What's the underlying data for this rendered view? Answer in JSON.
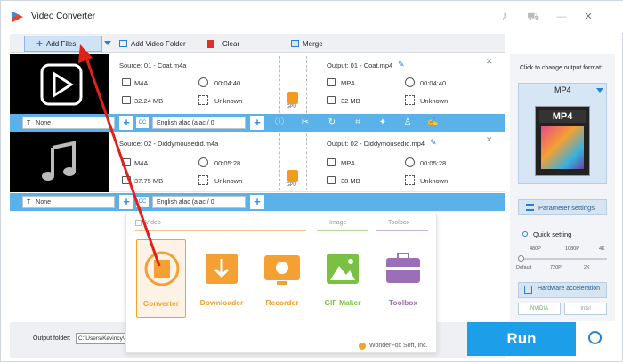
{
  "app": {
    "title": "Video Converter"
  },
  "toolbar": {
    "add_files": "Add Files",
    "add_video_folder": "Add Video Folder",
    "clear": "Clear",
    "merge": "Merge"
  },
  "files": [
    {
      "source": "Source: 01 - Coat.m4a",
      "src_format": "M4A",
      "src_duration": "00:04:40",
      "src_size": "32.24 MB",
      "src_res": "Unknown",
      "output": "Output: 01 - Coat.mp4",
      "out_format": "MP4",
      "out_duration": "00:04:40",
      "out_size": "32 MB",
      "out_res": "Unknown",
      "subtitle": "None",
      "audio": "English alac (alac / 0",
      "gpu_label": "GPU"
    },
    {
      "source": "Source: 02 - Diddymousedid.m4a",
      "src_format": "M4A",
      "src_duration": "00:05:28",
      "src_size": "37.75 MB",
      "src_res": "Unknown",
      "output": "Output: 02 - Diddymousedid.mp4",
      "out_format": "MP4",
      "out_duration": "00:05:28",
      "out_size": "38 MB",
      "out_res": "Unknown",
      "subtitle": "None",
      "audio": "English alac (alac / 0",
      "gpu_label": "GPU"
    }
  ],
  "right_panel": {
    "click_label": "Click to change output format:",
    "format": "MP4",
    "format_image_text": "MP4",
    "param_settings": "Parameter settings",
    "quick_setting": "Quick setting",
    "q_top": [
      "480P",
      "1080P",
      "4K"
    ],
    "q_bottom": [
      "Default",
      "720P",
      "2K"
    ],
    "hw_accel": "Hardware acceleration",
    "nvidia": "NVIDIA",
    "intel": "Intel"
  },
  "bottom": {
    "output_folder_label": "Output folder:",
    "output_folder_value": "C:\\Users\\Kevincy\\D",
    "run": "Run"
  },
  "popup": {
    "sections": [
      "Video",
      "Image",
      "Toolbox"
    ],
    "tiles": [
      "Converter",
      "Downloader",
      "Recorder",
      "GIF Maker",
      "Toolbox"
    ],
    "copyright": "WonderFox Soft, Inc."
  },
  "colors": {
    "accent": "#1d9ee8",
    "bar": "#5ab2e8",
    "orange": "#f5a033",
    "green": "#7ac143",
    "purple": "#9b6fb7"
  }
}
